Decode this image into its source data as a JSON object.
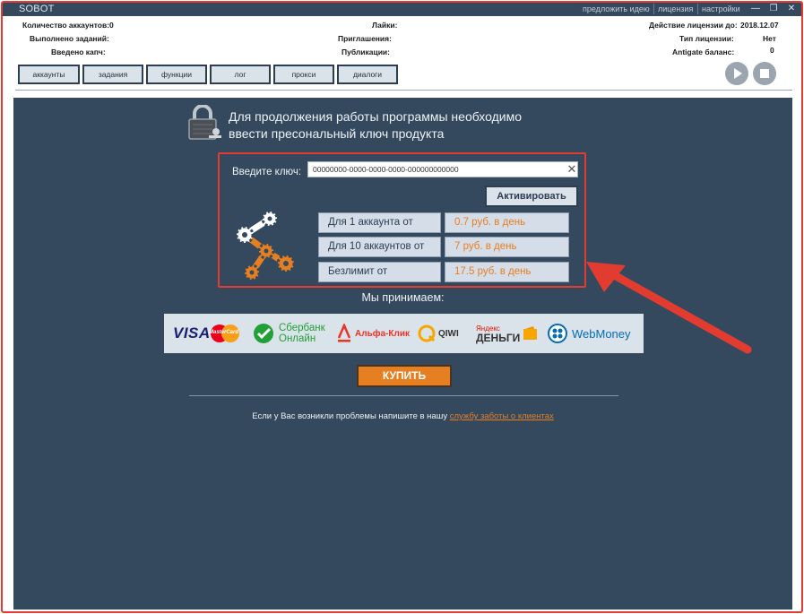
{
  "app": {
    "title": "SOBOT",
    "links": [
      "предложить идею",
      "лицензия",
      "настройки"
    ]
  },
  "stats": {
    "left": [
      {
        "label": "Количество аккаунтов:",
        "value": "0"
      },
      {
        "label": "Выполнено заданий:",
        "value": ""
      },
      {
        "label": "Введено капч:",
        "value": ""
      }
    ],
    "middle": [
      {
        "label": "Лайки:"
      },
      {
        "label": "Приглашения:"
      },
      {
        "label": "Публикации:"
      }
    ],
    "right": [
      {
        "label": "Действие лицензии до:",
        "value": "2018.12.07"
      },
      {
        "label": "Тип лицензии:",
        "value": "Нет"
      },
      {
        "label": "Antigate баланс:",
        "value": "0"
      }
    ]
  },
  "tabs": [
    "аккаунты",
    "задания",
    "функции",
    "лог",
    "прокси",
    "диалоги"
  ],
  "license": {
    "headline_1": "Для продолжения работы программы необходимо",
    "headline_2": "ввести пресональный ключ продукта",
    "key_label": "Введите ключ:",
    "key_value": "00000000-0000-0000-0000-000000000000",
    "activate_label": "Активировать",
    "prices": [
      {
        "label": "Для 1 аккаунта от",
        "price": "0.7 руб. в день"
      },
      {
        "label": "Для 10 аккаунтов от",
        "price": "7 руб. в день"
      },
      {
        "label": "Безлимит от",
        "price": "17.5 руб. в день"
      }
    ],
    "accept_label": "Мы принимаем:",
    "payments": {
      "visa": "VISA",
      "mastercard": "MasterCard",
      "sber_1": "Сбербанк",
      "sber_2": "Онлайн",
      "alfa": "Альфа-Клик",
      "qiwi": "QIWI",
      "yandex_1": "Яндекс",
      "yandex_2": "ДЕНЬГИ",
      "webmoney": "WebMoney"
    },
    "buy_label": "КУПИТЬ",
    "support_text": "Если у Вас возникли проблемы напишите в нашу ",
    "support_link": "службу заботы о клиентах"
  },
  "colors": {
    "panel": "#34495e",
    "accent": "#e67e22",
    "highlight": "#e23b30"
  }
}
